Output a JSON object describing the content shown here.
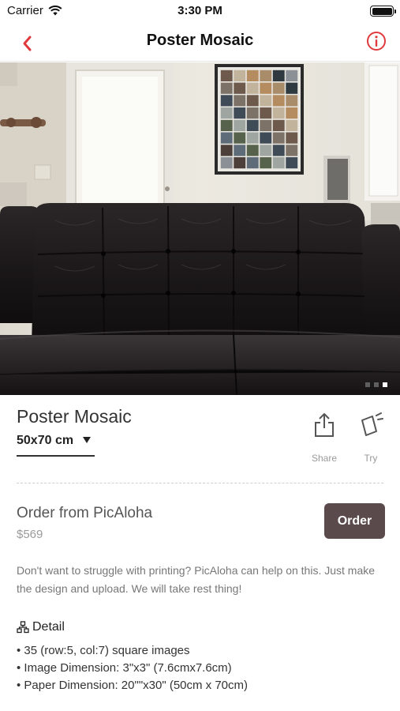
{
  "status_bar": {
    "carrier": "Carrier",
    "time": "3:30 PM",
    "icons": [
      "wifi-icon",
      "battery-icon"
    ]
  },
  "nav": {
    "title": "Poster Mosaic",
    "back_icon": "chevron-left-icon",
    "info_icon": "info-icon",
    "accent": "#e0393e"
  },
  "gallery": {
    "image": "leather-sofa-living-room-photo",
    "pages": 3,
    "current_page": 3
  },
  "product": {
    "title": "Poster Mosaic",
    "size": "50x70 cm",
    "actions": [
      {
        "label": "Share",
        "icon": "share-icon"
      },
      {
        "label": "Try",
        "icon": "try-poster-icon"
      }
    ]
  },
  "order": {
    "title": "Order from PicAloha",
    "price": "$569",
    "button_label": "Order",
    "button_color": "#5b4a4c"
  },
  "description": "Don't want to struggle with printing? PicAloha can help on this. Just make the design and upload. We will take rest thing!",
  "detail": {
    "heading": "Detail",
    "icon": "hierarchy-icon",
    "items": [
      "• 35 (row:5, col:7) square images",
      "• Image Dimension: 3\"x3\" (7.6cmx7.6cm)",
      "• Paper Dimension: 20\"\"x30\" (50cm x 70cm)"
    ]
  }
}
